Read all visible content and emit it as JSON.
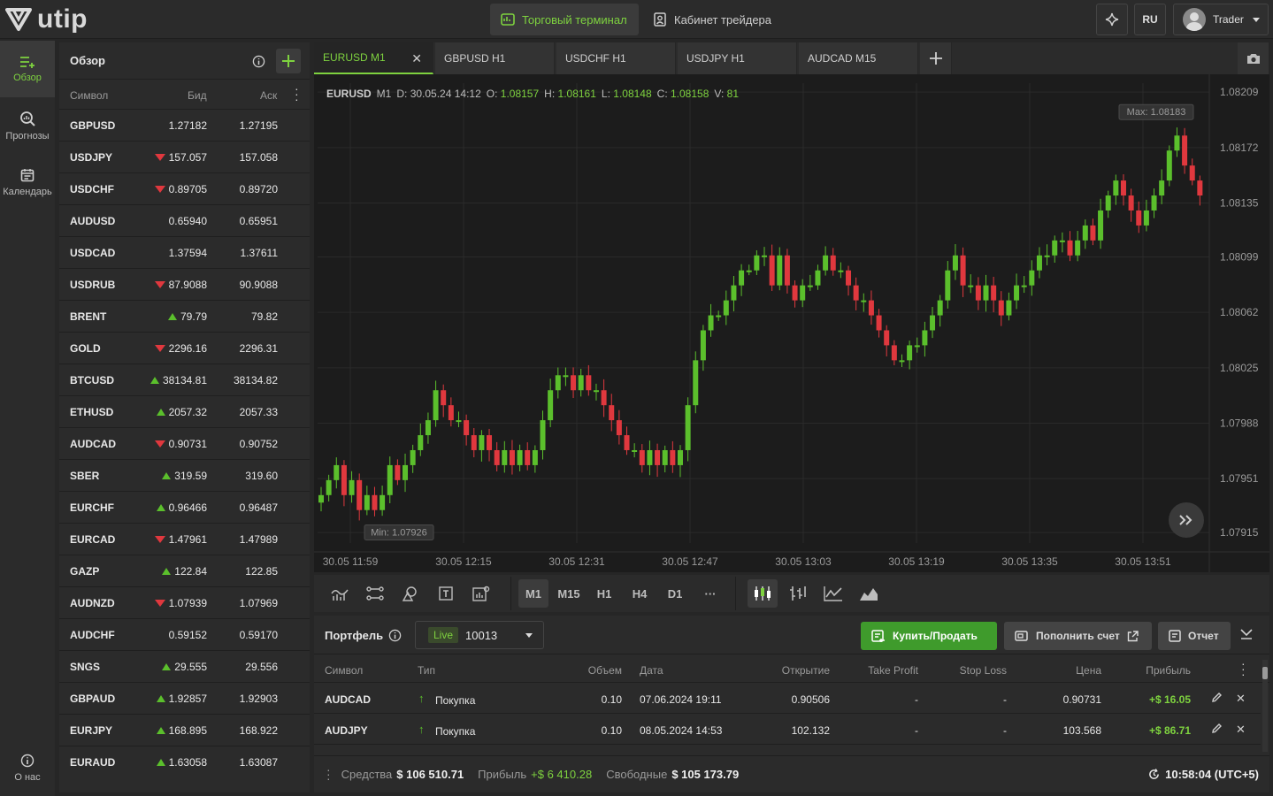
{
  "topbar": {
    "logo_text": "utip",
    "terminal_label": "Торговый терминал",
    "cabinet_label": "Кабинет трейдера",
    "lang": "RU",
    "user": "Trader"
  },
  "nav": {
    "items": [
      {
        "label": "Обзор",
        "icon": "list-add-icon"
      },
      {
        "label": "Прогнозы",
        "icon": "search-chart-icon"
      },
      {
        "label": "Календарь",
        "icon": "calendar-icon"
      }
    ],
    "about": "О нас"
  },
  "watchlist": {
    "title": "Обзор",
    "col_symbol": "Символ",
    "col_bid": "Бид",
    "col_ask": "Аск",
    "rows": [
      {
        "symbol": "GBPUSD",
        "bid": "1.27182",
        "ask": "1.27195",
        "dir": "none"
      },
      {
        "symbol": "USDJPY",
        "bid": "157.057",
        "ask": "157.058",
        "dir": "down"
      },
      {
        "symbol": "USDCHF",
        "bid": "0.89705",
        "ask": "0.89720",
        "dir": "down"
      },
      {
        "symbol": "AUDUSD",
        "bid": "0.65940",
        "ask": "0.65951",
        "dir": "none"
      },
      {
        "symbol": "USDCAD",
        "bid": "1.37594",
        "ask": "1.37611",
        "dir": "none"
      },
      {
        "symbol": "USDRUB",
        "bid": "87.9088",
        "ask": "90.9088",
        "dir": "down"
      },
      {
        "symbol": "BRENT",
        "bid": "79.79",
        "ask": "79.82",
        "dir": "up"
      },
      {
        "symbol": "GOLD",
        "bid": "2296.16",
        "ask": "2296.31",
        "dir": "down"
      },
      {
        "symbol": "BTCUSD",
        "bid": "38134.81",
        "ask": "38134.82",
        "dir": "up"
      },
      {
        "symbol": "ETHUSD",
        "bid": "2057.32",
        "ask": "2057.33",
        "dir": "up"
      },
      {
        "symbol": "AUDCAD",
        "bid": "0.90731",
        "ask": "0.90752",
        "dir": "down"
      },
      {
        "symbol": "SBER",
        "bid": "319.59",
        "ask": "319.60",
        "dir": "up"
      },
      {
        "symbol": "EURCHF",
        "bid": "0.96466",
        "ask": "0.96487",
        "dir": "up"
      },
      {
        "symbol": "EURCAD",
        "bid": "1.47961",
        "ask": "1.47989",
        "dir": "down"
      },
      {
        "symbol": "GAZP",
        "bid": "122.84",
        "ask": "122.85",
        "dir": "up"
      },
      {
        "symbol": "AUDNZD",
        "bid": "1.07939",
        "ask": "1.07969",
        "dir": "down"
      },
      {
        "symbol": "AUDCHF",
        "bid": "0.59152",
        "ask": "0.59170",
        "dir": "none"
      },
      {
        "symbol": "SNGS",
        "bid": "29.555",
        "ask": "29.556",
        "dir": "up"
      },
      {
        "symbol": "GBPAUD",
        "bid": "1.92857",
        "ask": "1.92903",
        "dir": "up"
      },
      {
        "symbol": "EURJPY",
        "bid": "168.895",
        "ask": "168.922",
        "dir": "up"
      },
      {
        "symbol": "EURAUD",
        "bid": "1.63058",
        "ask": "1.63087",
        "dir": "up"
      }
    ]
  },
  "tabs": [
    {
      "label": "EURUSD M1",
      "active": true
    },
    {
      "label": "GBPUSD H1",
      "active": false
    },
    {
      "label": "USDCHF H1",
      "active": false
    },
    {
      "label": "USDJPY H1",
      "active": false
    },
    {
      "label": "AUDCAD M15",
      "active": false
    }
  ],
  "chart_info": {
    "symbol": "EURUSD",
    "tf": "M1",
    "date_label": "D:",
    "date": "30.05.24 14:12",
    "o_label": "O:",
    "o": "1.08157",
    "h_label": "H:",
    "h": "1.08161",
    "l_label": "L:",
    "l": "1.08148",
    "c_label": "C:",
    "c": "1.08158",
    "v_label": "V:",
    "v": "81",
    "max_label": "Max: 1.08183",
    "min_label": "Min: 1.07926"
  },
  "chart_data": {
    "type": "candlestick",
    "symbol": "EURUSD",
    "timeframe": "M1",
    "ylim": [
      1.07908,
      1.08215
    ],
    "y_ticks": [
      "1.08209",
      "1.08172",
      "1.08135",
      "1.08099",
      "1.08062",
      "1.08025",
      "1.07988",
      "1.07951",
      "1.07915"
    ],
    "x_ticks": [
      "30.05 11:59",
      "30.05 12:15",
      "30.05 12:31",
      "30.05 12:47",
      "30.05 13:03",
      "30.05 13:19",
      "30.05 13:35",
      "30.05 13:51"
    ],
    "max": 1.08183,
    "min": 1.07926,
    "close_path": [
      1.0794,
      1.0795,
      1.0796,
      1.0794,
      1.0795,
      1.0793,
      1.0794,
      1.0793,
      1.0794,
      1.0796,
      1.0795,
      1.0796,
      1.0797,
      1.0798,
      1.0799,
      1.0801,
      1.08,
      1.0799,
      1.0799,
      1.0798,
      1.0797,
      1.0798,
      1.0797,
      1.0796,
      1.0797,
      1.0796,
      1.0797,
      1.0796,
      1.0797,
      1.0799,
      1.0801,
      1.0802,
      1.0802,
      1.0801,
      1.0802,
      1.0801,
      1.0801,
      1.08,
      1.0799,
      1.0798,
      1.0797,
      1.0797,
      1.0796,
      1.0797,
      1.0796,
      1.0797,
      1.0796,
      1.0797,
      1.08,
      1.0803,
      1.0805,
      1.0806,
      1.0806,
      1.0807,
      1.0808,
      1.0809,
      1.0809,
      1.081,
      1.081,
      1.0808,
      1.081,
      1.0808,
      1.0807,
      1.0808,
      1.0808,
      1.0809,
      1.081,
      1.0809,
      1.0809,
      1.0808,
      1.0807,
      1.0807,
      1.0806,
      1.0805,
      1.0804,
      1.0803,
      1.0803,
      1.0804,
      1.0804,
      1.0805,
      1.0806,
      1.0807,
      1.0809,
      1.081,
      1.0808,
      1.0808,
      1.0807,
      1.0808,
      1.0807,
      1.0806,
      1.0807,
      1.0808,
      1.0808,
      1.0809,
      1.081,
      1.081,
      1.0811,
      1.0811,
      1.081,
      1.0811,
      1.0812,
      1.0811,
      1.0813,
      1.0814,
      1.0815,
      1.0814,
      1.0813,
      1.0812,
      1.0813,
      1.0814,
      1.0815,
      1.0817,
      1.0818,
      1.0816,
      1.0815,
      1.0814
    ]
  },
  "chart_tools": {
    "timeframes": [
      "M1",
      "M15",
      "H1",
      "H4",
      "D1"
    ],
    "more": "···"
  },
  "portfolio": {
    "title": "Портфель",
    "live": "Live",
    "account": "10013",
    "trade_label": "Купить/Продать",
    "deposit_label": "Пополнить счет",
    "report_label": "Отчет",
    "cols": {
      "symbol": "Символ",
      "type": "Тип",
      "volume": "Объем",
      "date": "Дата",
      "open": "Открытие",
      "tp": "Take Profit",
      "sl": "Stop Loss",
      "price": "Цена",
      "profit": "Прибыль"
    },
    "rows": [
      {
        "symbol": "AUDCAD",
        "type": "Покупка",
        "volume": "0.10",
        "date": "07.06.2024 19:11",
        "open": "0.90506",
        "tp": "-",
        "sl": "-",
        "price": "0.90731",
        "profit": "+$ 16.05"
      },
      {
        "symbol": "AUDJPY",
        "type": "Покупка",
        "volume": "0.10",
        "date": "08.05.2024 14:53",
        "open": "102.132",
        "tp": "-",
        "sl": "-",
        "price": "103.568",
        "profit": "+$ 86.71"
      }
    ],
    "footer": {
      "equity_label": "Средства",
      "equity": "$ 106 510.71",
      "profit_label": "Прибыль",
      "profit": "+$ 6 410.28",
      "free_label": "Свободные",
      "free": "$ 105 173.79",
      "time": "10:58:04 (UTC+5)"
    }
  },
  "colors": {
    "accent": "#7ed23f",
    "up": "#5bbf2c",
    "down": "#e0383e",
    "bg": "#1c1c1c",
    "panel": "#2b2b2b"
  }
}
